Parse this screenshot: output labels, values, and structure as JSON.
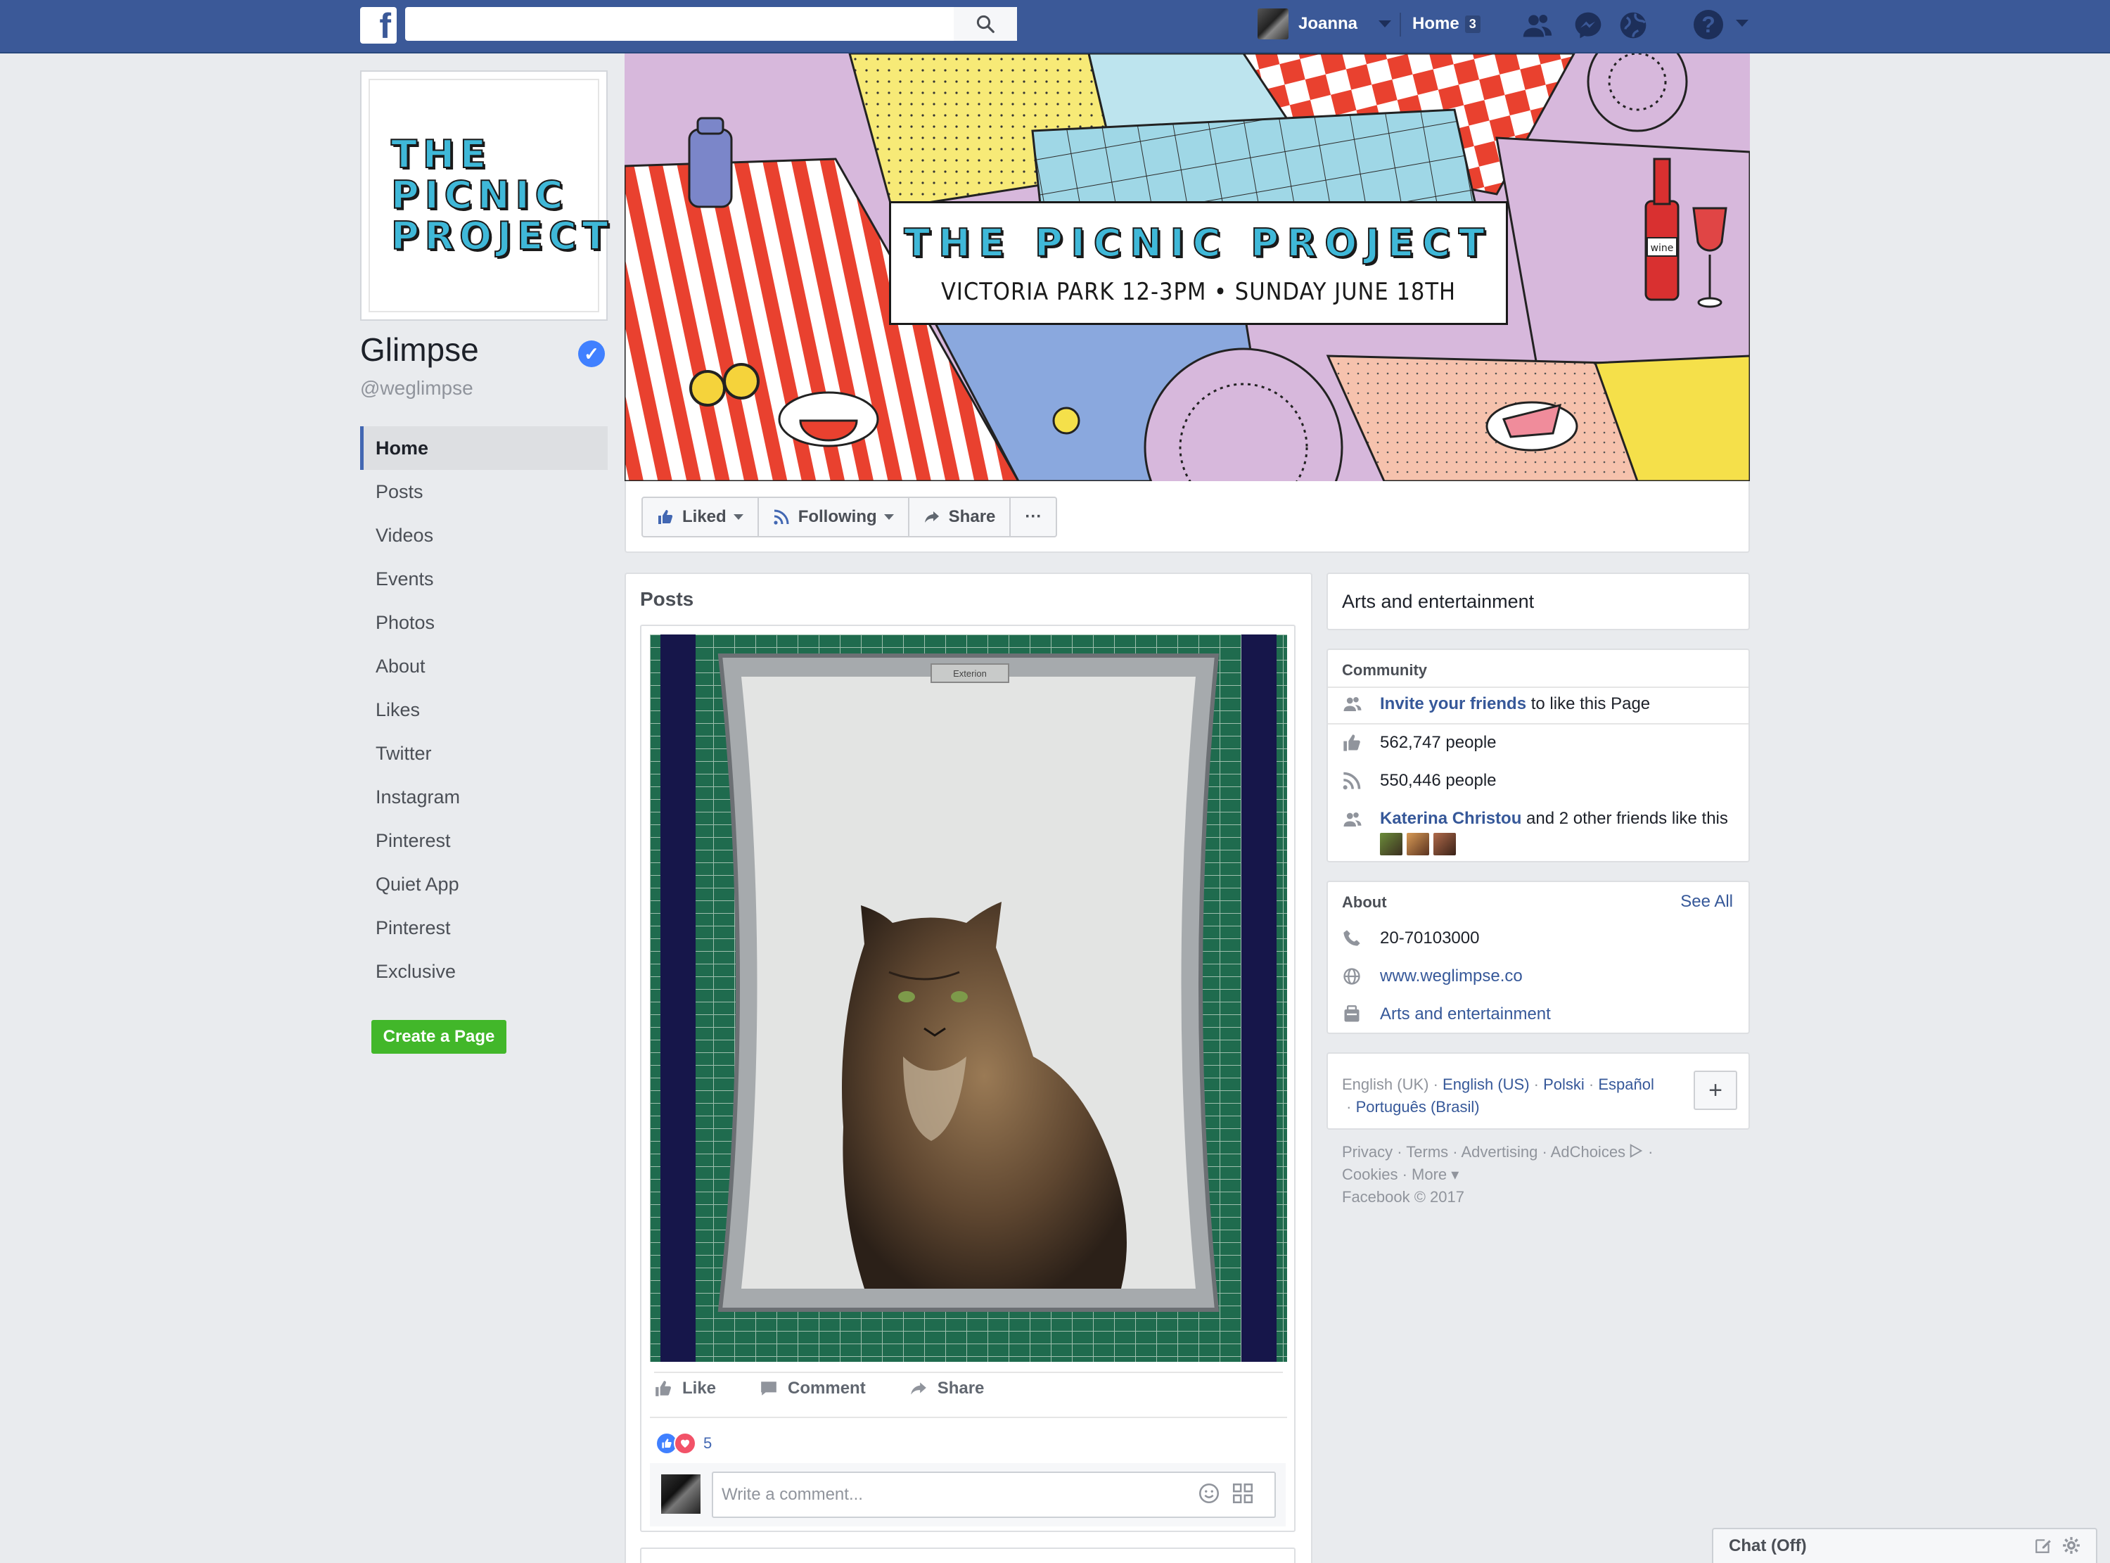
{
  "topbar": {
    "logo": "f",
    "search_placeholder": "",
    "user_name": "Joanna",
    "home_label": "Home",
    "home_count": "3"
  },
  "page": {
    "name": "Glimpse",
    "handle": "@weglimpse",
    "profile_lines": [
      "THE",
      "PICNIC",
      "PROJECT"
    ]
  },
  "nav": {
    "items": [
      "Home",
      "Posts",
      "Videos",
      "Events",
      "Photos",
      "About",
      "Likes",
      "Twitter",
      "Instagram",
      "Pinterest",
      "Quiet App",
      "Pinterest",
      "Exclusive"
    ],
    "active_index": 0,
    "create_page": "Create a Page"
  },
  "cover": {
    "title": "THE PICNIC PROJECT",
    "subtitle": "VICTORIA PARK 12-3PM • SUNDAY JUNE 18TH",
    "wine_label": "wine"
  },
  "actions": {
    "liked": "Liked",
    "following": "Following",
    "share": "Share",
    "more": "···"
  },
  "posts": {
    "title": "Posts",
    "sign_text": "Exterion",
    "like": "Like",
    "comment": "Comment",
    "share": "Share",
    "reaction_count": "5",
    "comment_placeholder": "Write a comment..."
  },
  "sidebar": {
    "category": "Arts and entertainment",
    "community": {
      "heading": "Community",
      "invite_link": "Invite your friends",
      "invite_rest": " to like this Page",
      "likes": "562,747 people",
      "follows": "550,446 people",
      "friend_name": "Katerina Christou",
      "friend_rest": " and 2 other friends like this"
    },
    "about": {
      "heading": "About",
      "see_all": "See All",
      "phone": "20-70103000",
      "website": "www.weglimpse.co",
      "category": "Arts and entertainment"
    },
    "languages": {
      "current": "English (UK)",
      "sep": " · ",
      "others": [
        "English (US)",
        "Polski",
        "Español",
        "Português (Brasil)"
      ]
    },
    "footer": {
      "line1": "Privacy · Terms · Advertising · AdChoices",
      "line1_tail": " ·",
      "line2": "Cookies · More ▾",
      "line3": "Facebook © 2017"
    }
  },
  "chat": {
    "label": "Chat (Off)"
  },
  "colors": {
    "brand": "#3b5998",
    "link": "#365899",
    "create_green": "#42b72a",
    "cover_accent": "#3fb8d8"
  }
}
